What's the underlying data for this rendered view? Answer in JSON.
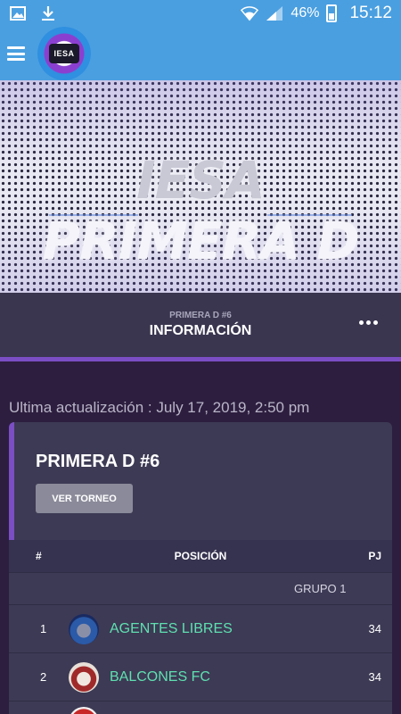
{
  "status_bar": {
    "icons_left": [
      "image-icon",
      "download-icon"
    ],
    "battery": "46%",
    "time": "15:12",
    "icons_right": [
      "wifi-icon",
      "signal-icon",
      "battery-icon"
    ]
  },
  "app_bar": {
    "logo_text": "IESA",
    "menu_icon": "hamburger-icon",
    "color": "#4a9fe0"
  },
  "banner": {
    "title_part1": "IESA",
    "title_part2": "PRIMERA D"
  },
  "info_bar": {
    "subtitle": "PRIMERA D #6",
    "title": "INFORMACIÓN",
    "more_icon": "more-dots-icon"
  },
  "last_update": "Ultima actualización : July 17, 2019, 2:50 pm",
  "card": {
    "title": "PRIMERA D #6",
    "button_label": "VER TORNEO",
    "table": {
      "headers": [
        "#",
        "POSICIÓN",
        "PJ"
      ],
      "group_label": "GRUPO 1",
      "rows": [
        {
          "pos": "1",
          "team": "AGENTES LIBRES",
          "pj": "34"
        },
        {
          "pos": "2",
          "team": "BALCONES FC",
          "pj": "34"
        }
      ]
    }
  },
  "colors": {
    "accent": "#7b4ec4",
    "team_link": "#5fe0b0",
    "background": "#2d1e3f"
  }
}
